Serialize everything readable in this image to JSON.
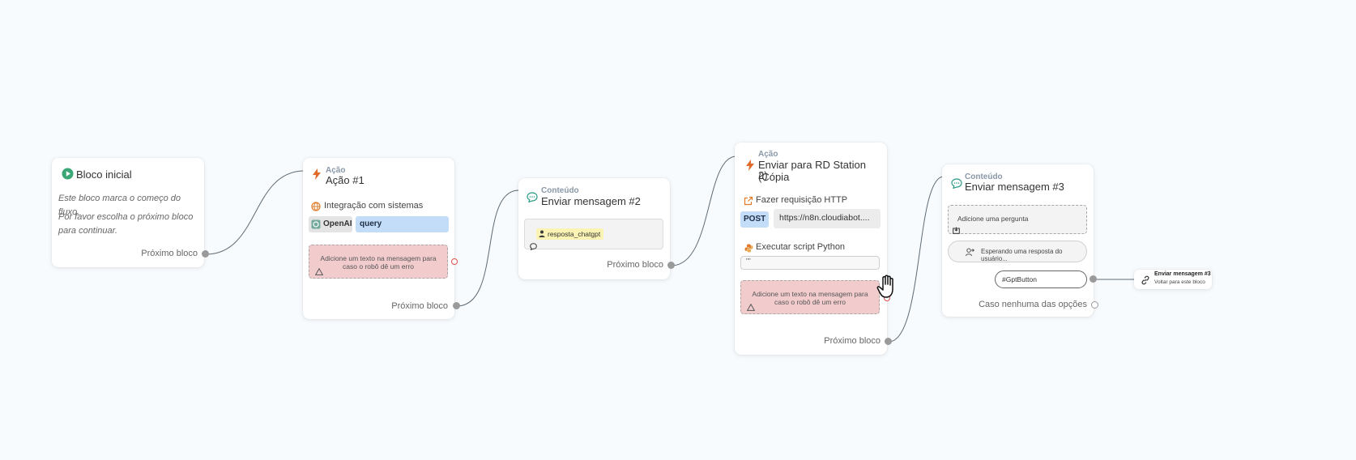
{
  "colors": {
    "background": "#f8fbfe",
    "accent_green": "#3ba776",
    "action_orange": "#e06a2b",
    "content_teal": "#2c9c86",
    "error_fill": "#f2cccd",
    "query_blue": "#c3dcf7",
    "variable_yellow": "#fbf3b4"
  },
  "start_node": {
    "icon": "play-circle-icon",
    "title": "Bloco inicial",
    "line1": "Este bloco marca o começo do fluxo.",
    "line2": "Por favor escolha o próximo bloco",
    "line3": "para continuar.",
    "next_label": "Próximo bloco"
  },
  "action1": {
    "icon": "lightning-icon",
    "kind": "Ação",
    "title": "Ação #1",
    "integration_icon": "globe-icon",
    "integration_title": "Integração com sistemas",
    "openai_label": "OpenAI",
    "query_label": "query",
    "error_text_line1": "Adicione um texto na mensagem para",
    "error_text_line2": "caso o robô dê um erro",
    "next_label": "Próximo bloco"
  },
  "message2": {
    "icon": "chat-bubble-icon",
    "kind": "Conteúdo",
    "title": "Enviar mensagem #2",
    "variable": "resposta_chatgpt",
    "next_label": "Próximo bloco"
  },
  "rd_action": {
    "icon": "lightning-icon",
    "kind": "Ação",
    "title_line1": "Enviar para RD Station (Cópia",
    "title_line2": "2)",
    "http_icon": "external-link-icon",
    "http_title": "Fazer requisição HTTP",
    "method": "POST",
    "url": "https://n8n.cloudiabot....",
    "python_icon": "python-icon",
    "python_title": "Executar script Python",
    "python_code": "\"\"",
    "error_text_line1": "Adicione um texto na mensagem para",
    "error_text_line2": "caso o robô dê um erro",
    "next_label": "Próximo bloco"
  },
  "message3": {
    "icon": "chat-bubble-icon",
    "kind": "Conteúdo",
    "title": "Enviar mensagem #3",
    "question_placeholder": "Adicione uma pergunta",
    "waiting_text": "Esperando uma resposta do usuário...",
    "button_label": "#GptButton",
    "fallback_label": "Caso nenhuma das opções"
  },
  "link_node": {
    "icon": "link-icon",
    "title": "Enviar mensagem #3",
    "subtitle": "Voltar para este bloco"
  }
}
